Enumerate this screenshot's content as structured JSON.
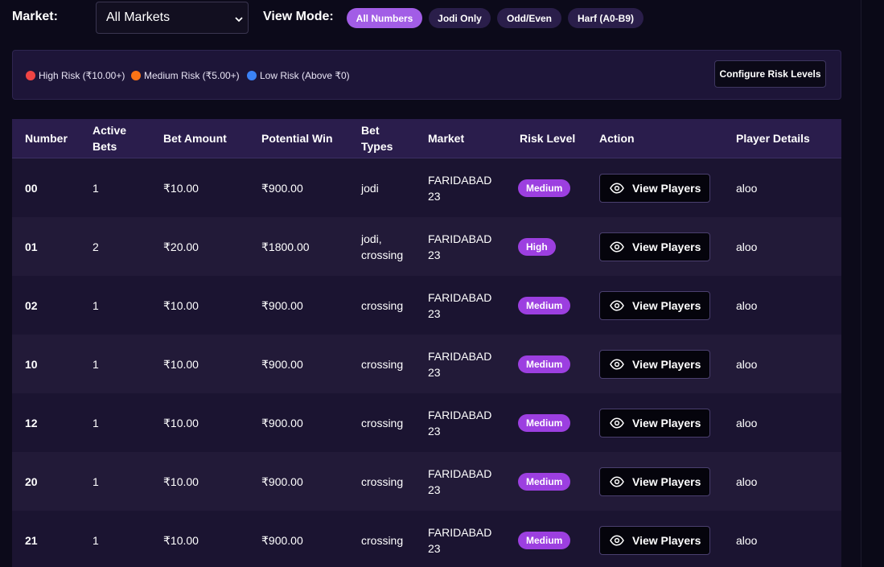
{
  "filters": {
    "market_label": "Market:",
    "market_value": "All Markets",
    "view_mode_label": "View Mode:",
    "view_modes": [
      "All Numbers",
      "Jodi Only",
      "Odd/Even",
      "Harf (A0-B9)"
    ],
    "active_view_mode": "All Numbers"
  },
  "risk_legend": {
    "items": [
      {
        "label": "High Risk (₹10.00+)",
        "color": "#ef4444"
      },
      {
        "label": "Medium Risk (₹5.00+)",
        "color": "#f97316"
      },
      {
        "label": "Low Risk (Above ₹0)",
        "color": "#3b82f6"
      }
    ],
    "configure_label": "Configure Risk Levels"
  },
  "table": {
    "headers": {
      "number": "Number",
      "active_bets_1": "Active",
      "active_bets_2": "Bets",
      "bet_amount": "Bet Amount",
      "potential_win": "Potential Win",
      "bet_types_1": "Bet",
      "bet_types_2": "Types",
      "market": "Market",
      "risk_level": "Risk Level",
      "action": "Action",
      "player_details": "Player Details"
    },
    "view_players_label": "View Players",
    "rows": [
      {
        "number": "00",
        "active_bets": "1",
        "bet_amount": "₹10.00",
        "potential_win": "₹900.00",
        "bet_types_1": "jodi",
        "bet_types_2": "",
        "market_1": "FARIDABAD",
        "market_2": "23",
        "risk": "Medium",
        "player": "aloo"
      },
      {
        "number": "01",
        "active_bets": "2",
        "bet_amount": "₹20.00",
        "potential_win": "₹1800.00",
        "bet_types_1": "jodi,",
        "bet_types_2": "crossing",
        "market_1": "FARIDABAD",
        "market_2": "23",
        "risk": "High",
        "player": "aloo"
      },
      {
        "number": "02",
        "active_bets": "1",
        "bet_amount": "₹10.00",
        "potential_win": "₹900.00",
        "bet_types_1": "crossing",
        "bet_types_2": "",
        "market_1": "FARIDABAD",
        "market_2": "23",
        "risk": "Medium",
        "player": "aloo"
      },
      {
        "number": "10",
        "active_bets": "1",
        "bet_amount": "₹10.00",
        "potential_win": "₹900.00",
        "bet_types_1": "crossing",
        "bet_types_2": "",
        "market_1": "FARIDABAD",
        "market_2": "23",
        "risk": "Medium",
        "player": "aloo"
      },
      {
        "number": "12",
        "active_bets": "1",
        "bet_amount": "₹10.00",
        "potential_win": "₹900.00",
        "bet_types_1": "crossing",
        "bet_types_2": "",
        "market_1": "FARIDABAD",
        "market_2": "23",
        "risk": "Medium",
        "player": "aloo"
      },
      {
        "number": "20",
        "active_bets": "1",
        "bet_amount": "₹10.00",
        "potential_win": "₹900.00",
        "bet_types_1": "crossing",
        "bet_types_2": "",
        "market_1": "FARIDABAD",
        "market_2": "23",
        "risk": "Medium",
        "player": "aloo"
      },
      {
        "number": "21",
        "active_bets": "1",
        "bet_amount": "₹10.00",
        "potential_win": "₹900.00",
        "bet_types_1": "crossing",
        "bet_types_2": "",
        "market_1": "FARIDABAD",
        "market_2": "23",
        "risk": "Medium",
        "player": "aloo"
      }
    ]
  },
  "colors": {
    "accent": "#a25de6",
    "badge": "#9c3fe0",
    "background": "#0c0a1a"
  },
  "icons": {
    "select_arrow": "chevron-down-icon",
    "view_players": "eye-icon"
  }
}
